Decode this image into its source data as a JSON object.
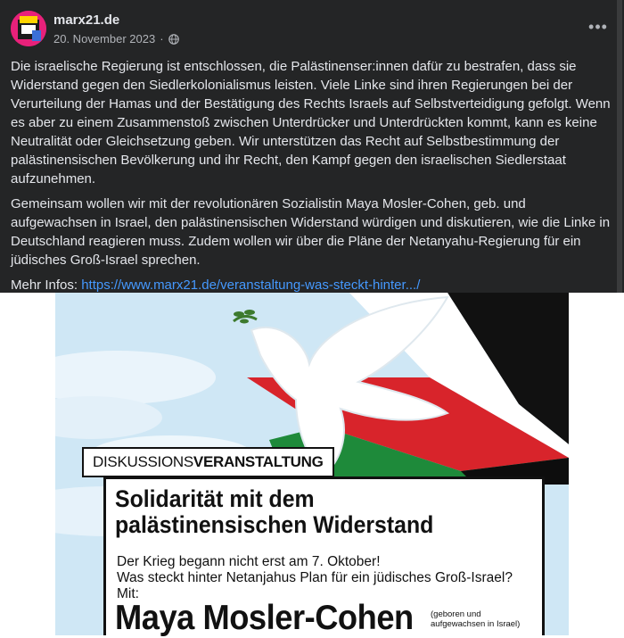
{
  "post": {
    "page_name": "marx21.de",
    "date": "20. November 2023",
    "paragraphs": [
      "Die israelische Regierung ist entschlossen, die Palästinenser:innen dafür zu bestrafen, dass sie Widerstand gegen den Siedlerkolonialismus leisten. Viele Linke sind ihren Regierungen bei der Verurteilung der Hamas und der Bestätigung des Rechts Israels auf Selbstverteidigung gefolgt. Wenn es aber zu einem Zusammenstoß zwischen Unterdrücker und Unterdrückten kommt, kann es keine Neutralität oder Gleichsetzung geben. Wir unterstützen das Recht auf Selbstbestimmung der palästinensischen Bevölkerung und ihr Recht, den Kampf gegen den israelischen Siedlerstaat aufzunehmen.",
      "Gemeinsam wollen wir mit der revolutionären Sozialistin Maya Mosler-Cohen, geb. und aufgewachsen in Israel, den palästinensischen Widerstand würdigen und diskutieren, wie die Linke in Deutschland reagieren muss. Zudem wollen wir über die Pläne der Netanyahu-Regierung für ein jüdisches Groß-Israel sprechen."
    ],
    "more_label": "Mehr Infos: ",
    "more_link": "https://www.marx21.de/veranstaltung-was-steckt-hinter.../",
    "icons": {
      "privacy": "globe-icon",
      "menu": "more-options-icon"
    }
  },
  "poster": {
    "label_light": "DISKUSSIONS",
    "label_bold": "VERANSTALTUNG",
    "title": "Solidarität mit dem palästinensischen Widerstand",
    "subtitle_line1": "Der Krieg begann nicht erst am 7. Oktober!",
    "subtitle_line2": "Was steckt hinter Netanjahus Plan für ein jüdisches Groß-Israel? Mit:",
    "speaker": "Maya Mosler-Cohen",
    "speaker_note": "(geboren und aufgewachsen in Israel)",
    "colors": {
      "sky": "#cfe7f5",
      "red": "#d8242b",
      "green": "#1e8a3a",
      "black": "#111111"
    }
  }
}
